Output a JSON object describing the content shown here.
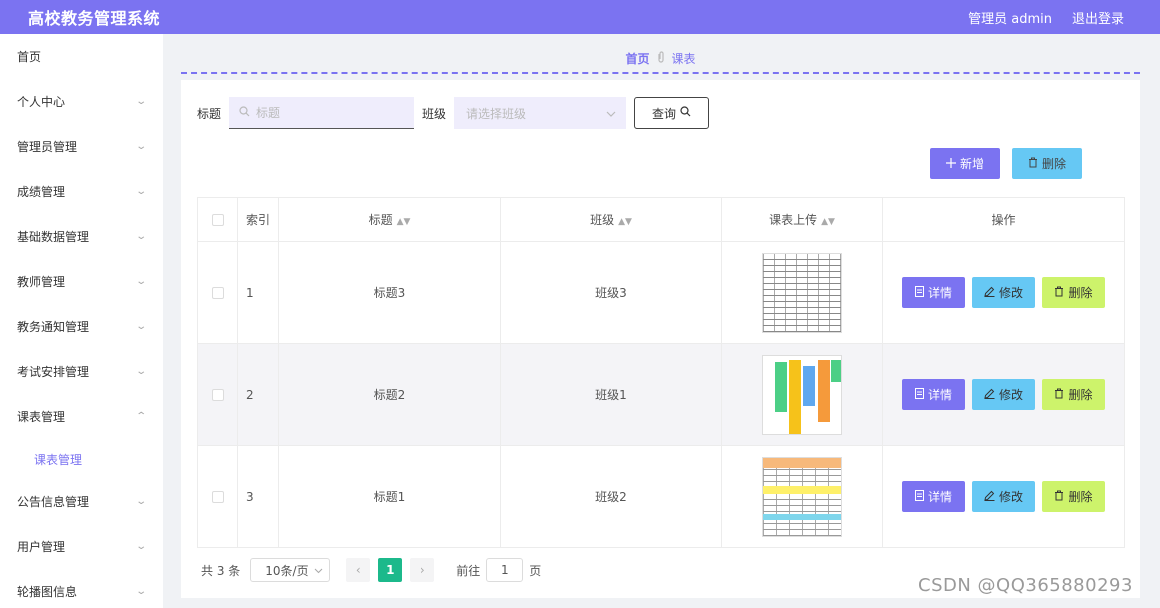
{
  "header": {
    "title": "高校教务管理系统",
    "user": "管理员 admin",
    "logout": "退出登录"
  },
  "sidebar": {
    "items": [
      {
        "label": "首页",
        "chevron": ""
      },
      {
        "label": "个人中心",
        "chevron": "⌄"
      },
      {
        "label": "管理员管理",
        "chevron": "⌄"
      },
      {
        "label": "成绩管理",
        "chevron": "⌄"
      },
      {
        "label": "基础数据管理",
        "chevron": "⌄"
      },
      {
        "label": "教师管理",
        "chevron": "⌄"
      },
      {
        "label": "教务通知管理",
        "chevron": "⌄"
      },
      {
        "label": "考试安排管理",
        "chevron": "⌄"
      },
      {
        "label": "课表管理",
        "chevron": "⌃"
      },
      {
        "label": "课表管理"
      },
      {
        "label": "公告信息管理",
        "chevron": "⌄"
      },
      {
        "label": "用户管理",
        "chevron": "⌄"
      },
      {
        "label": "轮播图信息",
        "chevron": "⌄"
      }
    ]
  },
  "breadcrumb": {
    "home": "首页",
    "current": "课表"
  },
  "search": {
    "title_label": "标题",
    "title_placeholder": "标题",
    "class_label": "班级",
    "class_placeholder": "请选择班级",
    "query_label": "查询"
  },
  "toolbar": {
    "add_label": "新增",
    "delete_label": "删除"
  },
  "table": {
    "headers": {
      "index": "索引",
      "title": "标题",
      "class": "班级",
      "upload": "课表上传",
      "ops": "操作"
    },
    "rows": [
      {
        "index": "1",
        "title": "标题3",
        "class": "班级3",
        "thumb": "grid"
      },
      {
        "index": "2",
        "title": "标题2",
        "class": "班级1",
        "thumb": "color"
      },
      {
        "index": "3",
        "title": "标题1",
        "class": "班级2",
        "thumb": "table"
      }
    ],
    "ops": {
      "detail": "详情",
      "edit": "修改",
      "delete": "删除"
    }
  },
  "pager": {
    "total": "共 3 条",
    "size": "10条/页",
    "current": "1",
    "goto": "前往",
    "goto_value": "1",
    "page_suffix": "页"
  },
  "watermark": "CSDN @QQ365880293",
  "colors": {
    "primary": "#7b73f1",
    "info": "#66c8f4",
    "warn": "#cdf36b",
    "pager_active": "#1cb98b"
  },
  "icons": {
    "search": "search-icon",
    "add": "plus-icon",
    "delete": "trash-icon",
    "detail": "document-icon",
    "edit": "pencil-icon",
    "sort": "sort-icon"
  }
}
